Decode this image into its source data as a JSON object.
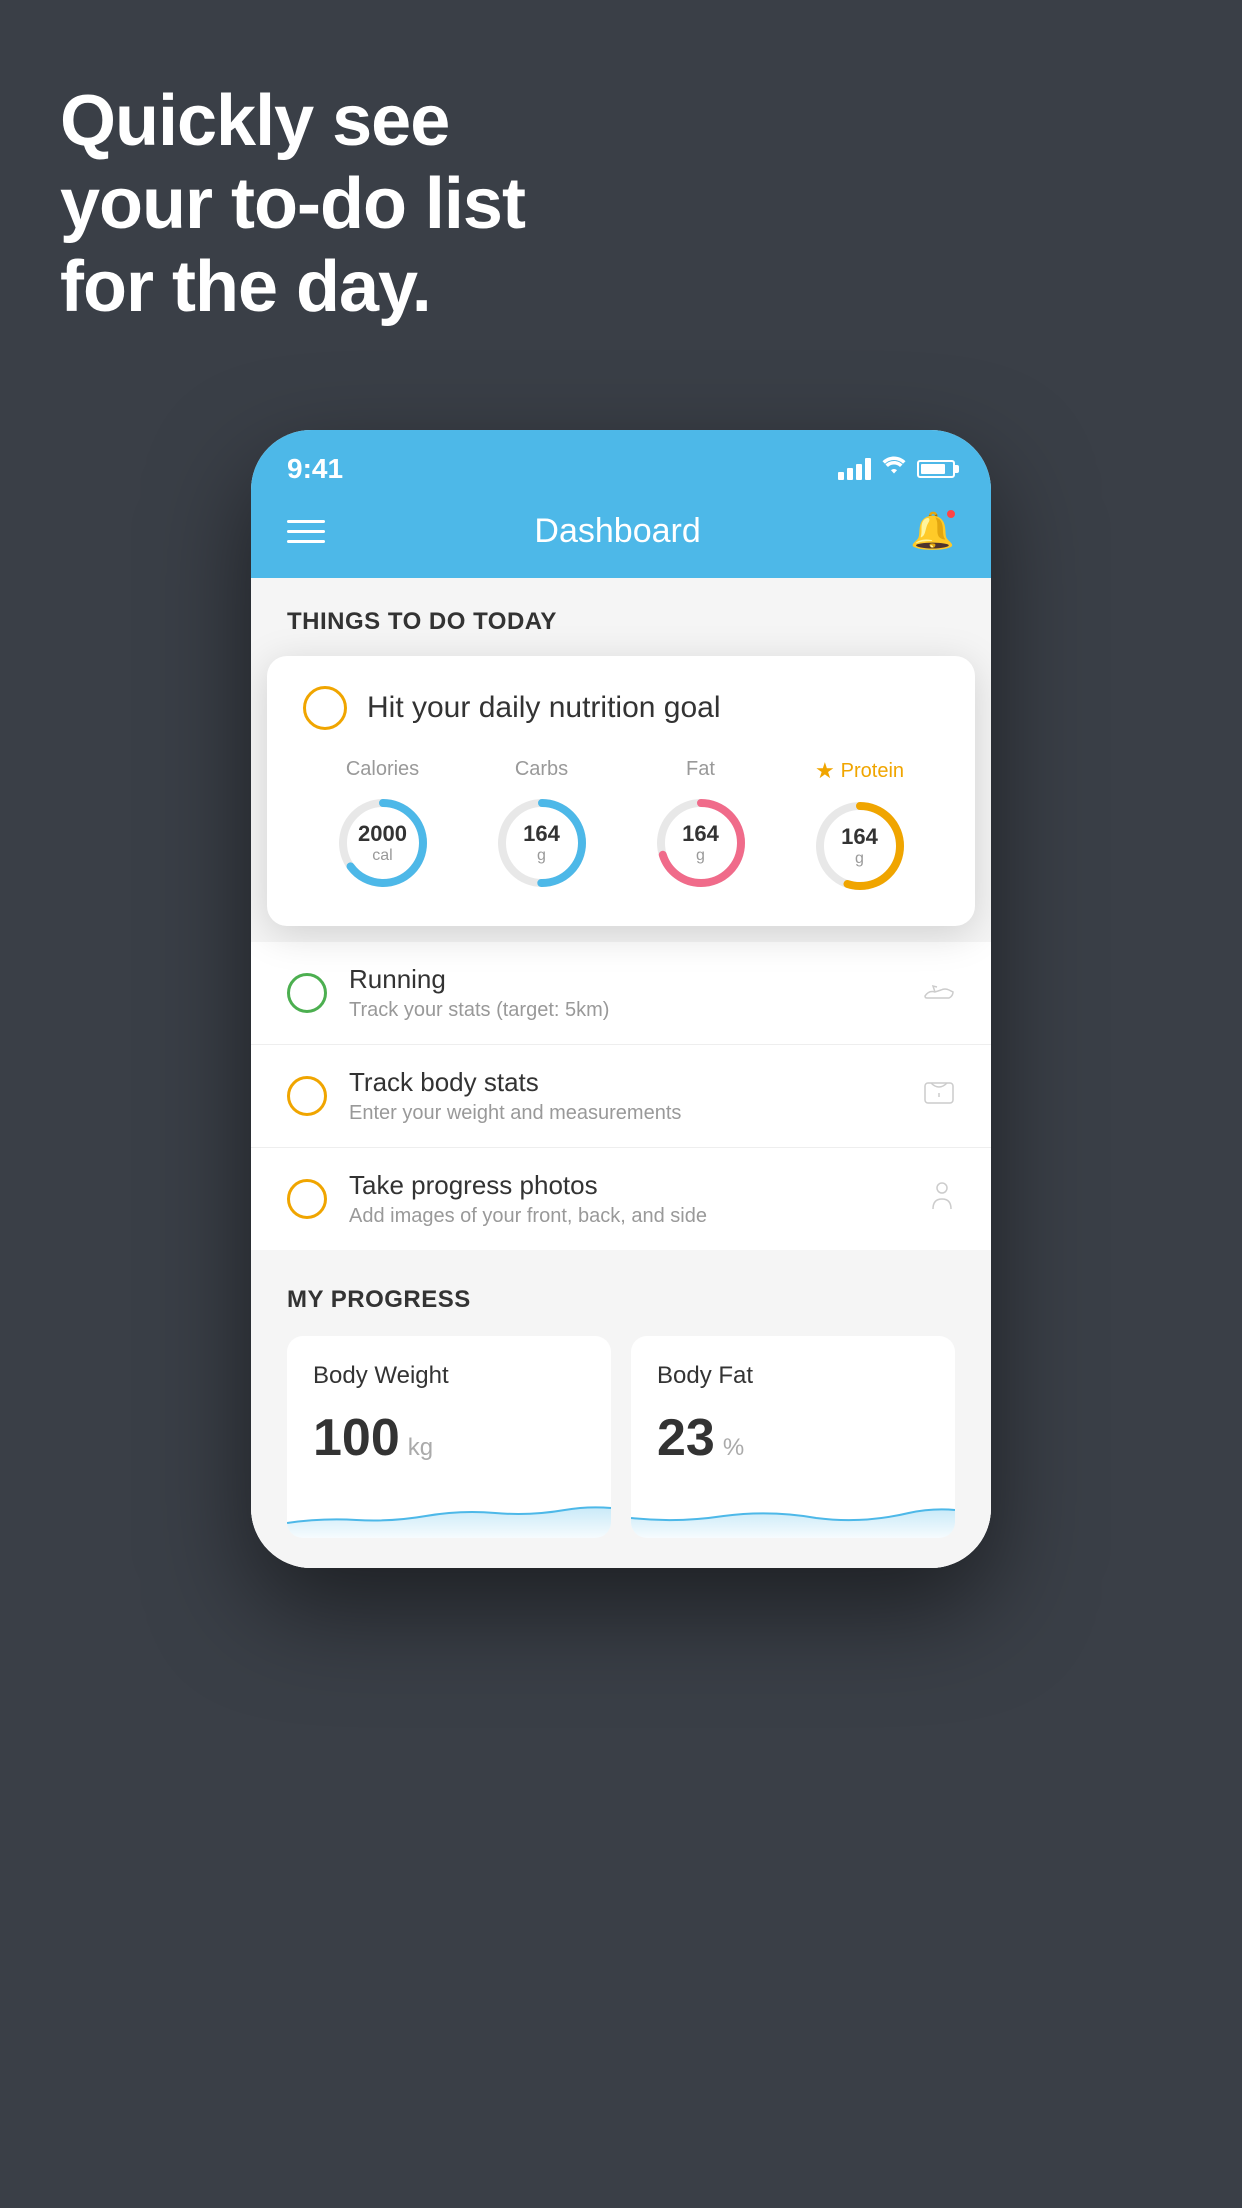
{
  "hero": {
    "line1": "Quickly see",
    "line2": "your to-do list",
    "line3": "for the day."
  },
  "phone": {
    "statusBar": {
      "time": "9:41"
    },
    "navBar": {
      "title": "Dashboard"
    },
    "thingsSection": {
      "title": "THINGS TO DO TODAY"
    },
    "nutritionCard": {
      "checkboxState": "unchecked",
      "title": "Hit your daily nutrition goal",
      "stats": [
        {
          "label": "Calories",
          "value": "2000",
          "unit": "cal",
          "color": "#4db8e8",
          "percent": 65,
          "starred": false
        },
        {
          "label": "Carbs",
          "value": "164",
          "unit": "g",
          "color": "#4db8e8",
          "percent": 50,
          "starred": false
        },
        {
          "label": "Fat",
          "value": "164",
          "unit": "g",
          "color": "#f06b8a",
          "percent": 70,
          "starred": false
        },
        {
          "label": "Protein",
          "value": "164",
          "unit": "g",
          "color": "#f0a500",
          "percent": 55,
          "starred": true
        }
      ]
    },
    "todoItems": [
      {
        "name": "Running",
        "desc": "Track your stats (target: 5km)",
        "circleColor": "green",
        "icon": "shoe"
      },
      {
        "name": "Track body stats",
        "desc": "Enter your weight and measurements",
        "circleColor": "yellow",
        "icon": "scale"
      },
      {
        "name": "Take progress photos",
        "desc": "Add images of your front, back, and side",
        "circleColor": "yellow",
        "icon": "person"
      }
    ],
    "progressSection": {
      "title": "MY PROGRESS",
      "cards": [
        {
          "title": "Body Weight",
          "value": "100",
          "unit": "kg"
        },
        {
          "title": "Body Fat",
          "value": "23",
          "unit": "%"
        }
      ]
    }
  }
}
